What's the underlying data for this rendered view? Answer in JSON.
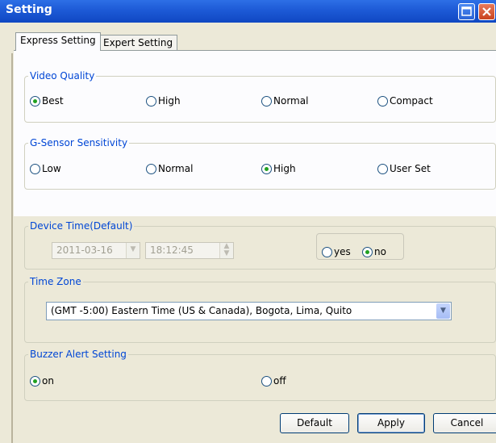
{
  "window": {
    "title": "Setting"
  },
  "tabs": [
    "Express Setting",
    "Expert Setting"
  ],
  "video_quality": {
    "legend": "Video Quality",
    "options": [
      "Best",
      "High",
      "Normal",
      "Compact"
    ],
    "selected": "Best"
  },
  "gsensor": {
    "legend": "G-Sensor Sensitivity",
    "options": [
      "Low",
      "Normal",
      "High",
      "User Set"
    ],
    "selected": "High"
  },
  "device_time": {
    "legend": "Device Time(Default)",
    "date": "2011-03-16",
    "time": "18:12:45",
    "yes_label": "yes",
    "no_label": "no",
    "selected": "no"
  },
  "time_zone": {
    "legend": "Time Zone",
    "value": "(GMT -5:00) Eastern Time (US & Canada), Bogota, Lima, Quito"
  },
  "buzzer": {
    "legend": "Buzzer Alert Setting",
    "on_label": "on",
    "off_label": "off",
    "selected": "on"
  },
  "buttons": {
    "default": "Default",
    "apply": "Apply",
    "cancel": "Cancel"
  }
}
